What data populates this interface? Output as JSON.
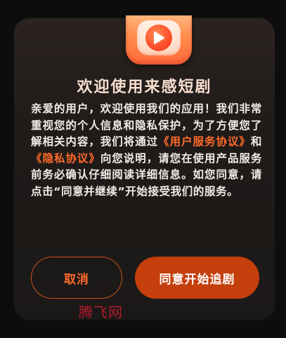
{
  "dialog": {
    "title": "欢迎使用来感短剧",
    "body_part1": "亲爱的用户，欢迎使用我们的应用！我们非常重视您的个人信息和隐私保护，为了方便您了解相关内容，我们将通过",
    "link_user_agreement": "《用户服务协议》",
    "body_and": "和",
    "link_privacy": "《隐私协议》",
    "body_part2": "向您说明，请您在使用产品服务前务必确认仔细阅读详细信息。如您同意，请点击“同意并继续”开始接受我们的服务。",
    "cancel_label": "取消",
    "agree_label": "同意开始追剧"
  },
  "watermark": "腾飞网",
  "colors": {
    "accent": "#ff6a2a",
    "agree_button": "#c43f0c",
    "title": "#f6ded0",
    "dialog_bg": "#1f1b19"
  },
  "icons": {
    "app_icon": "play-icon"
  }
}
